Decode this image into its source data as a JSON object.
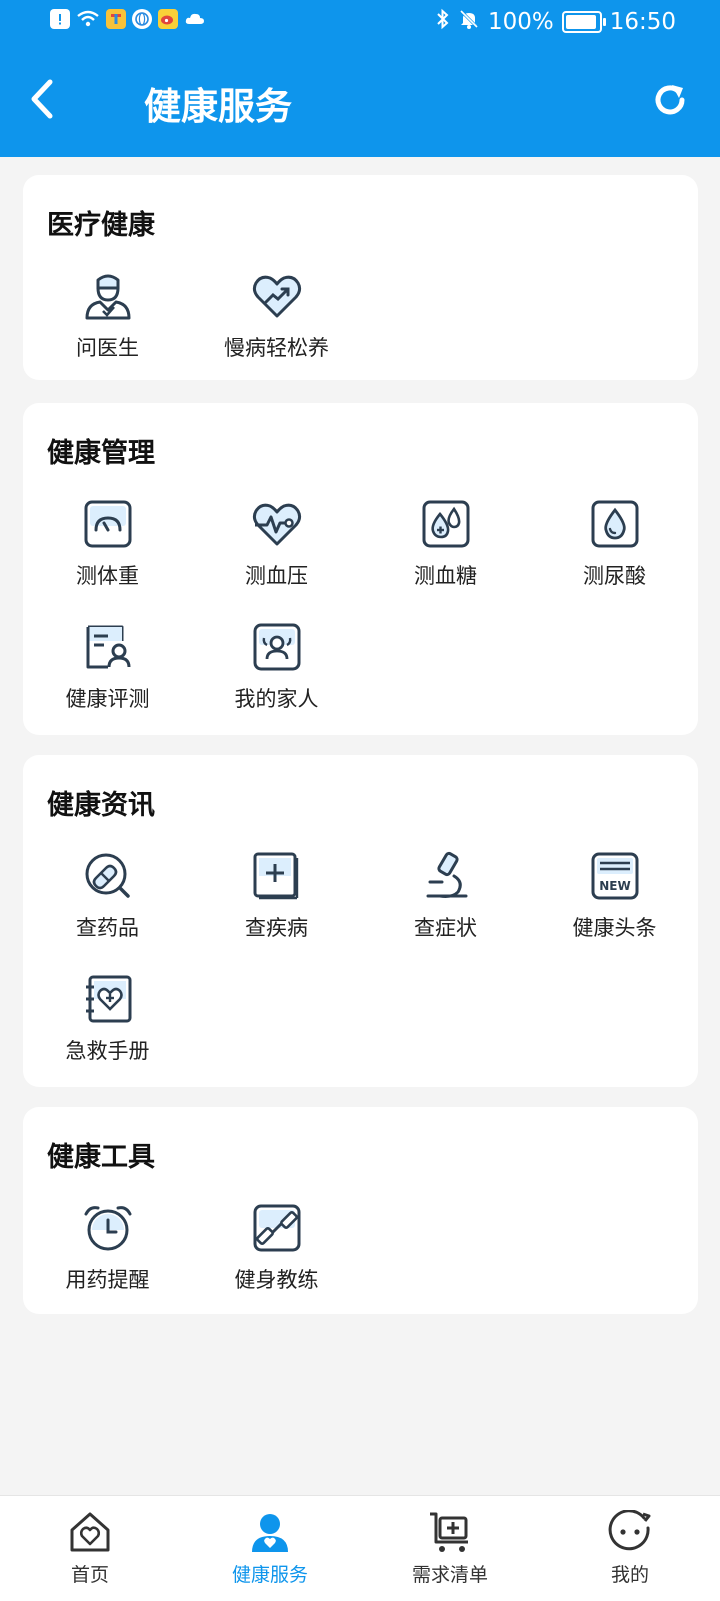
{
  "status_bar": {
    "battery_text": "100%",
    "time": "16:50",
    "battery_level": 0.95
  },
  "header": {
    "title": "健康服务"
  },
  "colors": {
    "primary": "#0e95ec",
    "icon_stroke": "#2c3e50",
    "icon_fill": "#dceefd"
  },
  "sections": [
    {
      "title": "医疗健康",
      "items": [
        {
          "label": "问医生",
          "icon": "doctor-icon"
        },
        {
          "label": "慢病轻松养",
          "icon": "heart-trend-icon"
        }
      ]
    },
    {
      "title": "健康管理",
      "items": [
        {
          "label": "测体重",
          "icon": "scale-icon"
        },
        {
          "label": "测血压",
          "icon": "heart-pulse-icon"
        },
        {
          "label": "测血糖",
          "icon": "blood-drop-plus-icon"
        },
        {
          "label": "测尿酸",
          "icon": "drop-icon"
        },
        {
          "label": "健康评测",
          "icon": "health-report-icon"
        },
        {
          "label": "我的家人",
          "icon": "family-icon"
        }
      ]
    },
    {
      "title": "健康资讯",
      "items": [
        {
          "label": "查药品",
          "icon": "pill-search-icon"
        },
        {
          "label": "查疾病",
          "icon": "medical-book-icon"
        },
        {
          "label": "查症状",
          "icon": "microscope-icon"
        },
        {
          "label": "健康头条",
          "icon": "news-icon"
        },
        {
          "label": "急救手册",
          "icon": "first-aid-book-icon"
        }
      ]
    },
    {
      "title": "健康工具",
      "items": [
        {
          "label": "用药提醒",
          "icon": "alarm-clock-icon"
        },
        {
          "label": "健身教练",
          "icon": "dumbbell-icon"
        }
      ]
    }
  ],
  "bottom_nav": [
    {
      "label": "首页",
      "icon": "home-icon",
      "active": false
    },
    {
      "label": "健康服务",
      "icon": "health-service-icon",
      "active": true
    },
    {
      "label": "需求清单",
      "icon": "cart-plus-icon",
      "active": false
    },
    {
      "label": "我的",
      "icon": "face-icon",
      "active": false
    }
  ]
}
